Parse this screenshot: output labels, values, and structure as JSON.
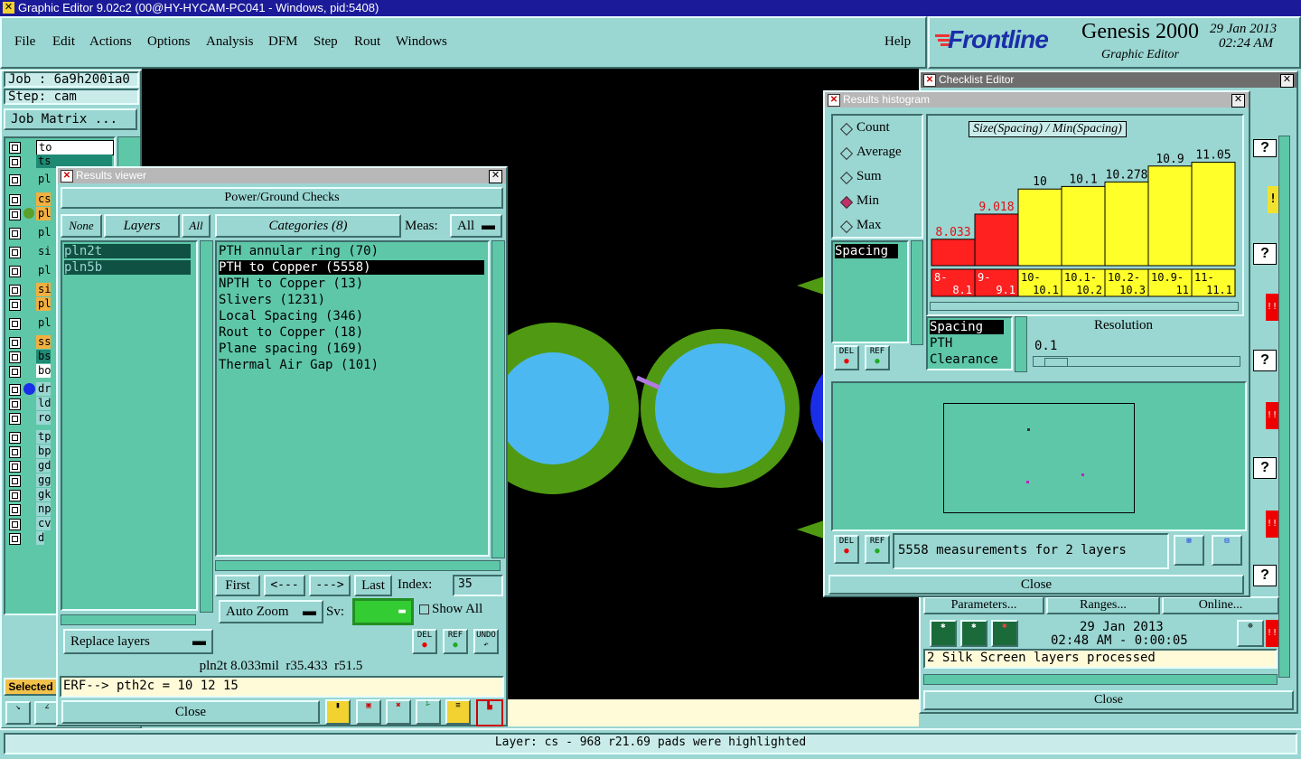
{
  "app": {
    "title_bar": "Graphic Editor 9.02c2 (00@HY-HYCAM-PC041 - Windows, pid:5408)",
    "menus": [
      "File",
      "Edit",
      "Actions",
      "Options",
      "Analysis",
      "DFM",
      "Step",
      "Rout",
      "Windows"
    ],
    "help": "Help",
    "brand": "Frontline",
    "product": "Genesis 2000",
    "product_sub": "Graphic Editor",
    "date": "29 Jan 2013",
    "time": "02:24 AM"
  },
  "left": {
    "job": "Job : 6a9h200ia0",
    "step": "Step: cam",
    "job_matrix": "Job Matrix ...",
    "layers": [
      "to",
      "ts",
      "pl",
      "cs",
      "pl",
      "pl",
      "si",
      "pl",
      "si",
      "pl",
      "pl",
      "ss",
      "bs",
      "bo",
      "dr",
      "ld",
      "ro",
      "tp",
      "bp",
      "gd",
      "gg",
      "gk",
      "np",
      "cv",
      "d"
    ],
    "selected": "Selected"
  },
  "results_viewer": {
    "title": "Results viewer",
    "header": "Power/Ground Checks",
    "none": "None",
    "layers_btn": "Layers",
    "all": "All",
    "layer_list": [
      "pln2t",
      "pln5b"
    ],
    "categories_btn": "Categories (8)",
    "meas_label": "Meas:",
    "meas_value": "All",
    "categories": [
      "PTH annular ring (70)",
      "PTH to Copper (5558)",
      "NPTH to Copper (13)",
      "Slivers (1231)",
      "Local Spacing (346)",
      "Rout to Copper (18)",
      "Plane spacing (169)",
      "Thermal Air Gap (101)"
    ],
    "first": "First",
    "prev": "<---",
    "next": "--->",
    "last": "Last",
    "index_label": "Index:",
    "index_value": "35",
    "auto_zoom": "Auto Zoom",
    "sv_label": "Sv:",
    "show_all": "Show All",
    "replace_layers": "Replace layers",
    "del": "DEL",
    "ref": "REF",
    "undo": "UNDO",
    "status": "pln2t 8.033mil  r35.433  r51.5",
    "erf": "ERF--> pth2c = 10 12 15",
    "close": "Close"
  },
  "histogram": {
    "title": "Results histogram",
    "modes": [
      "Count",
      "Average",
      "Sum",
      "Min",
      "Max"
    ],
    "selected_mode": "Min",
    "list_item": "Spacing",
    "chart_title": "Size(Spacing) / Min(Spacing)",
    "types": [
      "Spacing",
      "PTH",
      "Clearance"
    ],
    "resolution_label": "Resolution",
    "resolution_value": "0.1",
    "summary": "5558 measurements for 2 layers",
    "close": "Close",
    "del": "DEL",
    "ref": "REF"
  },
  "chart_data": {
    "type": "bar",
    "title": "Size(Spacing) / Min(Spacing)",
    "categories": [
      "8-8.1",
      "9-9.1",
      "10-10.1",
      "10.1-10.2",
      "10.2-10.3",
      "10.9-11",
      "11-11.1"
    ],
    "values": [
      8.033,
      9.018,
      10,
      10.1,
      10.278,
      10.9,
      11.05
    ],
    "value_labels": [
      "8.033",
      "9.018",
      "10",
      "10.1",
      "10.278",
      "10.9",
      "11.05"
    ],
    "colors": [
      "#ff2020",
      "#ff2020",
      "#ffff2a",
      "#ffff2a",
      "#ffff2a",
      "#ffff2a",
      "#ffff2a"
    ]
  },
  "checklist": {
    "title": "Checklist Editor",
    "params": "Parameters...",
    "ranges": "Ranges...",
    "online": "Online...",
    "date": "29 Jan 2013",
    "time": "02:48 AM - 0:00:05",
    "message": "2 Silk Screen layers processed",
    "close": "Close"
  },
  "status_bar": "Layer: cs - 968 r21.69 pads were highlighted"
}
